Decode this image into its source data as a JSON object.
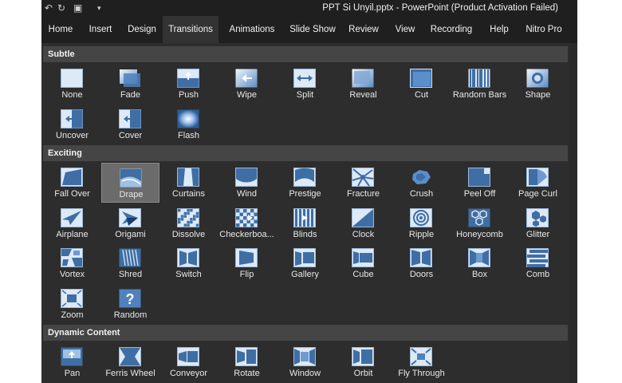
{
  "title": "PPT Si Unyil.pptx  -  PowerPoint (Product Activation Failed)",
  "tabs": [
    "Home",
    "Insert",
    "Design",
    "Transitions",
    "Animations",
    "Slide Show",
    "Review",
    "View",
    "Recording",
    "Help",
    "Nitro Pro"
  ],
  "active_tab": "Transitions",
  "sections": [
    {
      "title": "Subtle",
      "items": [
        {
          "label": "None",
          "icon": "none-icon"
        },
        {
          "label": "Fade",
          "icon": "fade-icon"
        },
        {
          "label": "Push",
          "icon": "push-icon"
        },
        {
          "label": "Wipe",
          "icon": "wipe-icon"
        },
        {
          "label": "Split",
          "icon": "split-icon"
        },
        {
          "label": "Reveal",
          "icon": "reveal-icon"
        },
        {
          "label": "Cut",
          "icon": "cut-icon"
        },
        {
          "label": "Random Bars",
          "icon": "random-bars-icon"
        },
        {
          "label": "Shape",
          "icon": "shape-icon"
        },
        {
          "label": "Uncover",
          "icon": "uncover-icon"
        },
        {
          "label": "Cover",
          "icon": "cover-icon"
        },
        {
          "label": "Flash",
          "icon": "flash-icon"
        }
      ]
    },
    {
      "title": "Exciting",
      "items": [
        {
          "label": "Fall Over",
          "icon": "fall-over-icon"
        },
        {
          "label": "Drape",
          "icon": "drape-icon",
          "selected": true
        },
        {
          "label": "Curtains",
          "icon": "curtains-icon"
        },
        {
          "label": "Wind",
          "icon": "wind-icon"
        },
        {
          "label": "Prestige",
          "icon": "prestige-icon"
        },
        {
          "label": "Fracture",
          "icon": "fracture-icon"
        },
        {
          "label": "Crush",
          "icon": "crush-icon"
        },
        {
          "label": "Peel Off",
          "icon": "peel-off-icon"
        },
        {
          "label": "Page Curl",
          "icon": "page-curl-icon"
        },
        {
          "label": "Airplane",
          "icon": "airplane-icon"
        },
        {
          "label": "Origami",
          "icon": "origami-icon"
        },
        {
          "label": "Dissolve",
          "icon": "dissolve-icon"
        },
        {
          "label": "Checkerboa...",
          "icon": "checkerboard-icon"
        },
        {
          "label": "Blinds",
          "icon": "blinds-icon"
        },
        {
          "label": "Clock",
          "icon": "clock-icon"
        },
        {
          "label": "Ripple",
          "icon": "ripple-icon"
        },
        {
          "label": "Honeycomb",
          "icon": "honeycomb-icon"
        },
        {
          "label": "Glitter",
          "icon": "glitter-icon"
        },
        {
          "label": "Vortex",
          "icon": "vortex-icon"
        },
        {
          "label": "Shred",
          "icon": "shred-icon"
        },
        {
          "label": "Switch",
          "icon": "switch-icon"
        },
        {
          "label": "Flip",
          "icon": "flip-icon"
        },
        {
          "label": "Gallery",
          "icon": "gallery-icon"
        },
        {
          "label": "Cube",
          "icon": "cube-icon"
        },
        {
          "label": "Doors",
          "icon": "doors-icon"
        },
        {
          "label": "Box",
          "icon": "box-icon"
        },
        {
          "label": "Comb",
          "icon": "comb-icon"
        },
        {
          "label": "Zoom",
          "icon": "zoom-icon"
        },
        {
          "label": "Random",
          "icon": "random-icon"
        }
      ]
    },
    {
      "title": "Dynamic Content",
      "items": [
        {
          "label": "Pan",
          "icon": "pan-icon"
        },
        {
          "label": "Ferris Wheel",
          "icon": "ferris-wheel-icon"
        },
        {
          "label": "Conveyor",
          "icon": "conveyor-icon"
        },
        {
          "label": "Rotate",
          "icon": "rotate-icon"
        },
        {
          "label": "Window",
          "icon": "window-icon"
        },
        {
          "label": "Orbit",
          "icon": "orbit-icon"
        },
        {
          "label": "Fly Through",
          "icon": "fly-through-icon"
        }
      ]
    }
  ],
  "colors": {
    "panel": "#2d2d2d",
    "section_header": "#454545",
    "ribbon": "#1f1f1f",
    "thumb_light": "#dce9f7",
    "thumb_dark": "#3f6ea5",
    "selected": "#6b6b6b"
  }
}
